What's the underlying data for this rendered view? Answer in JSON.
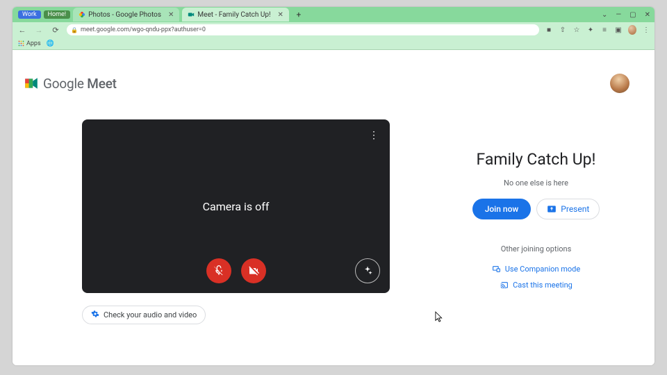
{
  "browser": {
    "pills": [
      {
        "label": "Work",
        "class": "work"
      },
      {
        "label": "Home!",
        "class": "home"
      }
    ],
    "tabs": [
      {
        "label": "Photos - Google Photos",
        "active": false
      },
      {
        "label": "Meet - Family Catch Up!",
        "active": true
      }
    ],
    "address": "meet.google.com/wgo-qndu-ppx?authuser=0",
    "bookmarks": {
      "apps": "Apps"
    }
  },
  "brand": {
    "text1": "Google",
    "text2": "Meet"
  },
  "preview": {
    "camera_status": "Camera is off",
    "check_audio_video": "Check your audio and video"
  },
  "meeting": {
    "title": "Family Catch Up!",
    "status": "No one else is here",
    "join_label": "Join now",
    "present_label": "Present",
    "other_options": "Other joining options",
    "companion": "Use Companion mode",
    "cast": "Cast this meeting"
  }
}
